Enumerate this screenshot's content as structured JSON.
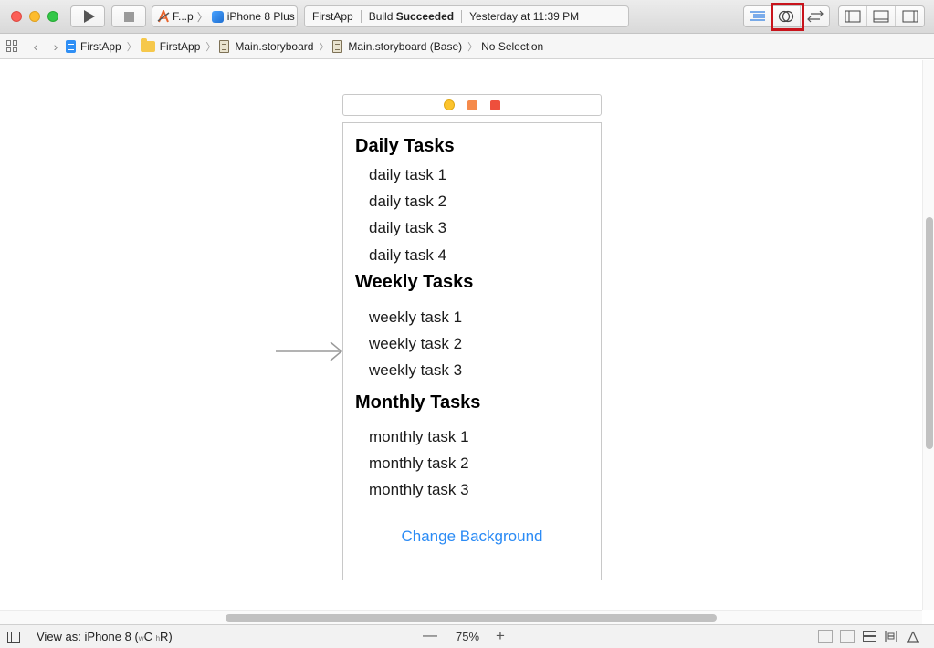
{
  "toolbar": {
    "scheme_name": "F...p",
    "device_name": "iPhone 8 Plus",
    "activity_project": "FirstApp",
    "activity_build_prefix": "Build",
    "activity_build_status": "Succeeded",
    "activity_time": "Yesterday at 11:39 PM",
    "highlight_color": "#c8131b"
  },
  "jumpbar": {
    "items": [
      "FirstApp",
      "FirstApp",
      "Main.storyboard",
      "Main.storyboard (Base)",
      "No Selection"
    ]
  },
  "scene": {
    "sections": [
      {
        "title": "Daily Tasks",
        "tasks": [
          "daily task 1",
          "daily task 2",
          "daily task 3",
          "daily task 4"
        ]
      },
      {
        "title": "Weekly Tasks",
        "tasks": [
          "weekly task 1",
          "weekly task 2",
          "weekly task 3"
        ]
      },
      {
        "title": "Monthly Tasks",
        "tasks": [
          "monthly task 1",
          "monthly task 2",
          "monthly task 3"
        ]
      }
    ],
    "button_label": "Change Background",
    "button_color": "#2b8bf5"
  },
  "bottombar": {
    "view_as_prefix": "View as: iPhone 8 (",
    "size_w": "w",
    "size_w_class": "C",
    "size_h": "h",
    "size_h_class": "R",
    "view_as_suffix": ")",
    "zoom_minus": "—",
    "zoom": "75%",
    "zoom_plus": "+"
  }
}
